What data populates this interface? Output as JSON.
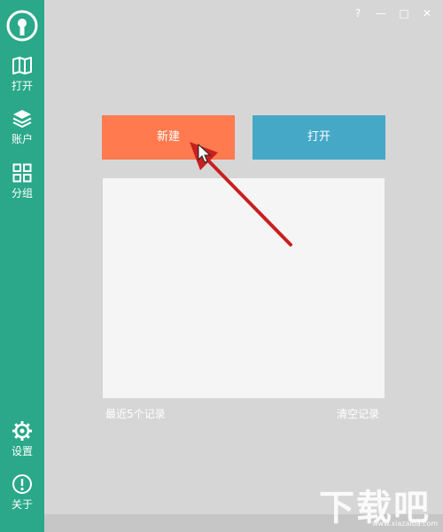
{
  "colors": {
    "sidebar": "#2aa889",
    "new_button": "#ff7b4f",
    "open_button": "#45a8c7",
    "background": "#d6d6d6",
    "panel": "#f5f5f5",
    "arrow": "#c8201f"
  },
  "titlebar": {
    "help": "?",
    "minimize": "—",
    "maximize": "□",
    "close": "✕"
  },
  "sidebar": {
    "logo_icon": "keyhole-icon",
    "items": [
      {
        "label": "打开",
        "icon": "book-icon"
      },
      {
        "label": "账户",
        "icon": "layers-icon"
      },
      {
        "label": "分组",
        "icon": "grid-icon"
      },
      {
        "label": "设置",
        "icon": "gear-icon"
      },
      {
        "label": "关于",
        "icon": "info-icon"
      }
    ]
  },
  "main": {
    "new_label": "新建",
    "open_label": "打开",
    "recent_label": "最近5个记录",
    "clear_label": "清空记录"
  },
  "watermark": {
    "text": "下载吧",
    "sub": "www.xiazaiba.com"
  }
}
